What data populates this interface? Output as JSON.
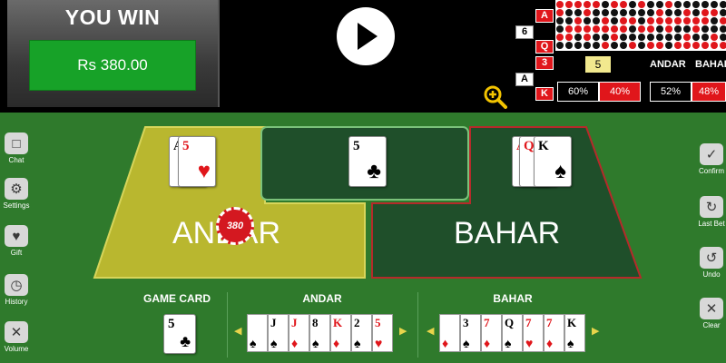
{
  "result": {
    "title": "YOU WIN",
    "amount": "Rs 380.00"
  },
  "history": [
    {
      "label": "A",
      "style": "red"
    },
    {
      "label": "6",
      "style": "white"
    },
    {
      "label": "Q",
      "style": "red"
    },
    {
      "label": "3",
      "style": "red"
    },
    {
      "label": "A",
      "style": "white"
    },
    {
      "label": "K",
      "style": "red"
    }
  ],
  "stats": {
    "badge": "5",
    "andar_label": "ANDAR",
    "bahar_label": "BAHAR",
    "andar_pct": [
      "60%",
      "40%"
    ],
    "bahar_pct": [
      "52%",
      "48%"
    ]
  },
  "table": {
    "andar_label": "ANDAR",
    "bahar_label": "BAHAR",
    "andar_card": {
      "rank": "5",
      "suit": "♥",
      "color": "red",
      "under": [
        "A"
      ]
    },
    "joker_card": {
      "rank": "5",
      "suit": "♣",
      "color": "black"
    },
    "bahar_card": {
      "rank": "K",
      "suit": "♠",
      "color": "black",
      "under": [
        "A",
        "Q"
      ]
    },
    "chip_amount": "380"
  },
  "tools_left": [
    "Chat",
    "Settings",
    "Gift",
    "History",
    "Volume"
  ],
  "tools_right": [
    "Confirm",
    "Last Bet",
    "Undo",
    "Clear"
  ],
  "bottom": {
    "game_card_label": "GAME CARD",
    "andar_label": "ANDAR",
    "bahar_label": "BAHAR",
    "game_card": {
      "rank": "5",
      "suit": "♣",
      "color": "black"
    },
    "andar_cards": [
      {
        "rank": "",
        "suit": "♠",
        "color": "black"
      },
      {
        "rank": "J",
        "suit": "♠",
        "color": "black"
      },
      {
        "rank": "J",
        "suit": "♦",
        "color": "red"
      },
      {
        "rank": "8",
        "suit": "♠",
        "color": "black"
      },
      {
        "rank": "K",
        "suit": "♦",
        "color": "red"
      },
      {
        "rank": "2",
        "suit": "♠",
        "color": "black"
      },
      {
        "rank": "5",
        "suit": "♥",
        "color": "red"
      }
    ],
    "bahar_cards": [
      {
        "rank": "",
        "suit": "♦",
        "color": "red"
      },
      {
        "rank": "3",
        "suit": "♠",
        "color": "black"
      },
      {
        "rank": "7",
        "suit": "♦",
        "color": "red"
      },
      {
        "rank": "Q",
        "suit": "♠",
        "color": "black"
      },
      {
        "rank": "7",
        "suit": "♥",
        "color": "red"
      },
      {
        "rank": "7",
        "suit": "♦",
        "color": "red"
      },
      {
        "rank": "K",
        "suit": "♠",
        "color": "black"
      }
    ]
  },
  "colors": {
    "felt": "#2f7a2c",
    "andar_zone": "#b9b72f",
    "bahar_zone": "#1f4f2a",
    "joker_zone": "#1f4f2a",
    "red": "#e0161b",
    "win_green": "#17a228"
  },
  "icons": {
    "play": "play-icon",
    "zoom": "zoom-in-icon",
    "chat": "chat-icon",
    "settings": "gear-icon",
    "gift": "heart-gift-icon",
    "history": "clock-icon",
    "volume": "speaker-mute-icon",
    "confirm": "check-icon",
    "last_bet": "repeat-icon",
    "undo": "undo-icon",
    "clear": "close-icon"
  }
}
